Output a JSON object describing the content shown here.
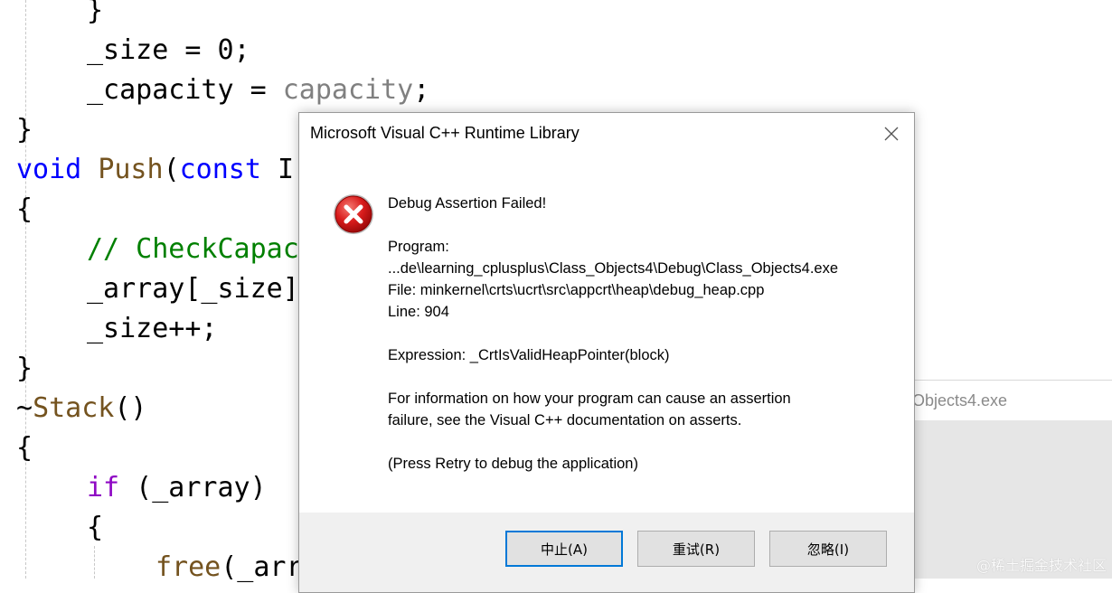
{
  "editor": {
    "lines": {
      "l1": {
        "brace": "}"
      },
      "l2": {
        "text": "_size = 0;"
      },
      "l3": {
        "prefix": "_capacity = ",
        "param": "capacity",
        "suffix": ";"
      },
      "l4": {
        "brace": "}"
      },
      "l5": {
        "kw": "void",
        "fn": "Push",
        "paren": "(",
        "kw2": "const",
        "rest": " I"
      },
      "l6": {
        "brace": "{"
      },
      "l7": {
        "comment": "// CheckCapaci"
      },
      "l8": {
        "text": "_array[_size]"
      },
      "l9": {
        "text": "_size++;"
      },
      "l10": {
        "brace": "}"
      },
      "l11": {
        "tilde": "~",
        "fn": "Stack",
        "rest": "()"
      },
      "l12": {
        "brace": "{"
      },
      "l13": {
        "kw": "if",
        "rest": " (_array)"
      },
      "l14": {
        "brace": "{"
      },
      "l15": {
        "fn": "free",
        "rest": "(_arr"
      }
    },
    "colors": {
      "keyword": "#0000ff",
      "control": "#8f08c4",
      "function": "#74531f",
      "comment": "#008000",
      "parameter": "#808080"
    }
  },
  "console": {
    "title": "Objects4.exe",
    "watermark": "@稀土掘金技术社区"
  },
  "dialog": {
    "title": "Microsoft Visual C++ Runtime Library",
    "icon": "error-icon",
    "heading": "Debug Assertion Failed!",
    "program_label": "Program:",
    "program_path": "...de\\learning_cplusplus\\Class_Objects4\\Debug\\Class_Objects4.exe",
    "file_line": "File: minkernel\\crts\\ucrt\\src\\appcrt\\heap\\debug_heap.cpp",
    "line_line": "Line: 904",
    "expression": "Expression: _CrtIsValidHeapPointer(block)",
    "info_line1": "For information on how your program can cause an assertion",
    "info_line2": "failure, see the Visual C++ documentation on asserts.",
    "press_retry": "(Press Retry to debug the application)",
    "buttons": {
      "abort": "中止(A)",
      "retry": "重试(R)",
      "ignore": "忽略(I)"
    }
  }
}
